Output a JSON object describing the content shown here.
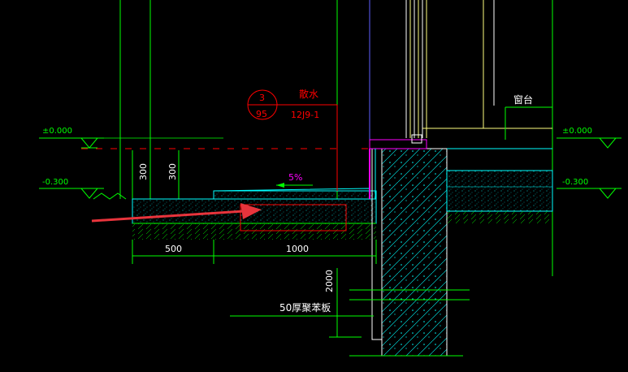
{
  "drawing": {
    "elev_zero_left": "±0.000",
    "elev_minus_left": "-0.300",
    "elev_zero_right": "±0.000",
    "elev_minus_right": "-0.300",
    "detail_number": "3",
    "detail_sheet": "95",
    "detail_title": "散水",
    "detail_ref": "12J9-1",
    "slope": "5%",
    "dim_300_a": "300",
    "dim_300_b": "300",
    "dim_500": "500",
    "dim_1000": "1000",
    "dim_2000": "2000",
    "board_note": "50厚聚苯板",
    "sill_note": "窗台"
  },
  "colors": {
    "green": "#00ff00",
    "cyan": "#00ffff",
    "red": "#ff0000",
    "magenta": "#ff00ff",
    "yellow": "#ffff80",
    "white": "#ffffff",
    "arrow": "#e8343c",
    "blue": "#6060ff"
  }
}
